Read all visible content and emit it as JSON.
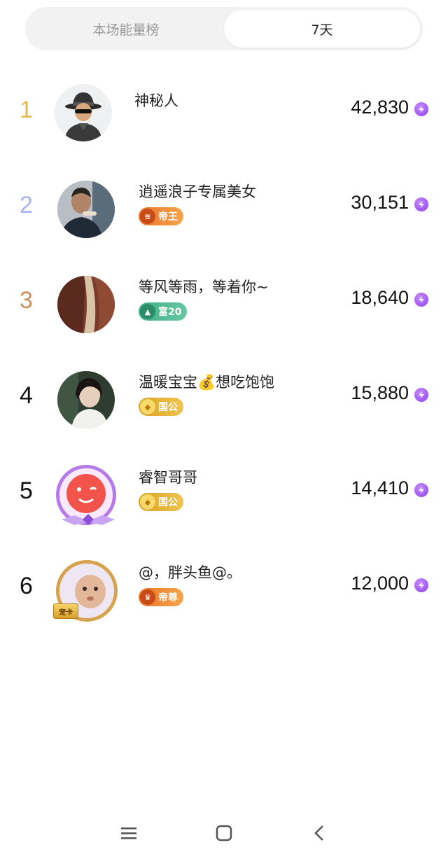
{
  "tabs": [
    {
      "label": "本场能量榜",
      "active": false
    },
    {
      "label": "7天",
      "active": true
    }
  ],
  "colors": {
    "rank1": "#e9b64a",
    "rank2": "#a9b2ec",
    "rank3": "#c8915f",
    "rank_other": "#111111",
    "energy_purple": "#8b3df0"
  },
  "ranking": [
    {
      "rank": "1",
      "name": "神秘人",
      "score": "42,830",
      "badge": null,
      "avatar": "mystery-person"
    },
    {
      "rank": "2",
      "name": "逍遥浪子专属美女",
      "score": "30,151",
      "badge": {
        "label": "帝王",
        "style": "orange"
      },
      "avatar": "user-photo"
    },
    {
      "rank": "3",
      "name": "等风等雨，等着你~",
      "score": "18,640",
      "badge": {
        "label": "富20",
        "style": "green"
      },
      "avatar": "user-photo"
    },
    {
      "rank": "4",
      "name": "温暖宝宝💰想吃饱饱",
      "score": "15,880",
      "badge": {
        "label": "国公",
        "style": "gold"
      },
      "avatar": "user-photo"
    },
    {
      "rank": "5",
      "name": "睿智哥哥",
      "score": "14,410",
      "badge": {
        "label": "国公",
        "style": "gold"
      },
      "avatar": "wink-face"
    },
    {
      "rank": "6",
      "name": "@，胖头鱼@。",
      "score": "12,000",
      "badge": {
        "label": "帝尊",
        "style": "orange"
      },
      "avatar": "baby-photo",
      "frame_label": "宠卡"
    }
  ],
  "navbar": [
    "menu-icon",
    "home-icon",
    "back-icon"
  ]
}
